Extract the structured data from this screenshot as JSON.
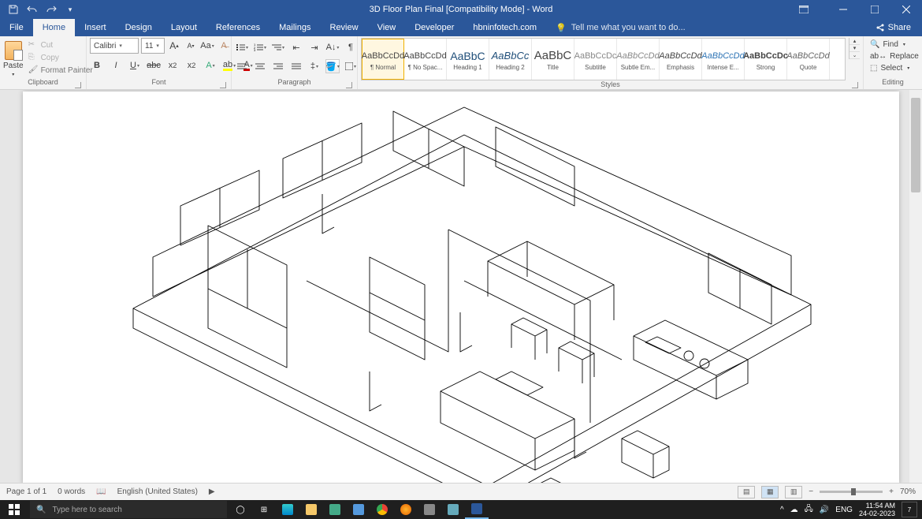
{
  "titlebar": {
    "title": "3D Floor Plan Final [Compatibility Mode] - Word"
  },
  "tabs": {
    "file": "File",
    "items": [
      "Home",
      "Insert",
      "Design",
      "Layout",
      "References",
      "Mailings",
      "Review",
      "View",
      "Developer",
      "hbninfotech.com"
    ],
    "active": "Home",
    "tellme_icon": "💡",
    "tellme": "Tell me what you want to do...",
    "share": "Share"
  },
  "ribbon": {
    "clipboard": {
      "paste": "Paste",
      "cut": "Cut",
      "copy": "Copy",
      "painter": "Format Painter",
      "label": "Clipboard"
    },
    "font": {
      "name": "Calibri",
      "size": "11",
      "label": "Font"
    },
    "paragraph": {
      "label": "Paragraph"
    },
    "styles": {
      "label": "Styles",
      "items": [
        {
          "sample": "AaBbCcDd",
          "name": "¶ Normal",
          "cls": "",
          "sel": true
        },
        {
          "sample": "AaBbCcDd",
          "name": "¶ No Spac...",
          "cls": ""
        },
        {
          "sample": "AaBbC",
          "name": "Heading 1",
          "cls": "color:#1f4e79;font-size:14px"
        },
        {
          "sample": "AaBbCc",
          "name": "Heading 2",
          "cls": "color:#1f4e79;font-size:13px;font-style:italic"
        },
        {
          "sample": "AaBbC",
          "name": "Title",
          "cls": "font-size:15px"
        },
        {
          "sample": "AaBbCcDc",
          "name": "Subtitle",
          "cls": "color:#888"
        },
        {
          "sample": "AaBbCcDd",
          "name": "Subtle Em...",
          "cls": "color:#888;font-style:italic"
        },
        {
          "sample": "AaBbCcDd",
          "name": "Emphasis",
          "cls": "font-style:italic"
        },
        {
          "sample": "AaBbCcDd",
          "name": "Intense E...",
          "cls": "color:#2e74b5;font-style:italic"
        },
        {
          "sample": "AaBbCcDc",
          "name": "Strong",
          "cls": "font-weight:bold"
        },
        {
          "sample": "AaBbCcDd",
          "name": "Quote",
          "cls": "font-style:italic;color:#666"
        }
      ]
    },
    "editing": {
      "find": "Find",
      "replace": "Replace",
      "select": "Select",
      "label": "Editing"
    }
  },
  "status": {
    "page": "Page 1 of 1",
    "words": "0 words",
    "lang": "English (United States)",
    "zoom": "70%"
  },
  "taskbar": {
    "search_placeholder": "Type here to search",
    "lang": "ENG",
    "time": "11:54 AM",
    "date": "24-02-2023",
    "notif": "7"
  }
}
